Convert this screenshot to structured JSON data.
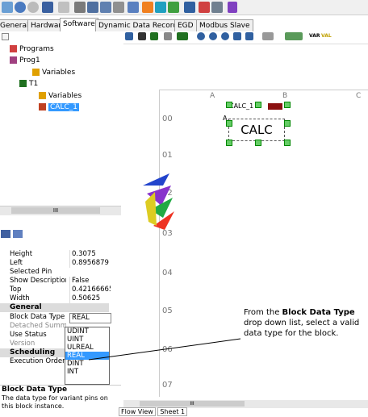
{
  "tabs": [
    "General",
    "Hardware",
    "Software",
    "Dynamic Data Recorders",
    "EGD",
    "Modbus Slave"
  ],
  "active_tab": "Software",
  "tree": [
    {
      "label": "Programs",
      "indent": 1
    },
    {
      "label": "Prog1",
      "indent": 2
    },
    {
      "label": "Variables",
      "indent": 3
    },
    {
      "label": "T1",
      "indent": 2
    },
    {
      "label": "Variables",
      "indent": 3
    },
    {
      "label": "CALC_1",
      "indent": 3,
      "selected": true
    }
  ],
  "scroll_label": "III",
  "properties": [
    {
      "name": "Height",
      "value": "0.3075"
    },
    {
      "name": "Left",
      "value": "0.8956879"
    },
    {
      "name": "Selected Pin",
      "value": ""
    },
    {
      "name": "Show Description",
      "value": "False"
    },
    {
      "name": "Top",
      "value": "0.421666652"
    },
    {
      "name": "Width",
      "value": "0.50625"
    }
  ],
  "cat_general": "General",
  "general_props": [
    {
      "name": "Block Data Type",
      "value": "REAL"
    },
    {
      "name": "Detached Summ",
      "value": ""
    },
    {
      "name": "Use Status",
      "value": ""
    },
    {
      "name": "Version",
      "value": ""
    }
  ],
  "cat_scheduling": "Scheduling",
  "sched_props": [
    {
      "name": "Execution Order",
      "value": ""
    }
  ],
  "dropdown_options": [
    "UDINT",
    "UINT",
    "ULREAL",
    "REAL",
    "DINT",
    "INT"
  ],
  "selected_option": "REAL",
  "desc_title": "Block Data Type",
  "desc_text": "The data type for variant pins on this block instance.",
  "toolbar_right_labels": [
    "VAR",
    "VAL"
  ],
  "columns": [
    "A",
    "B",
    "C"
  ],
  "rows": [
    "00",
    "01",
    "02",
    "03",
    "04",
    "05",
    "06",
    "07"
  ],
  "block": {
    "title": "CALC_1",
    "main": "CALC",
    "pin": "A"
  },
  "callout": {
    "prefix": "From the ",
    "bold": "Block Data Type",
    "suffix": " drop down list, select a valid data type for the block."
  },
  "sheet_tabs": [
    "Flow View",
    "Sheet 1"
  ],
  "sheet_scroll_label": "III"
}
